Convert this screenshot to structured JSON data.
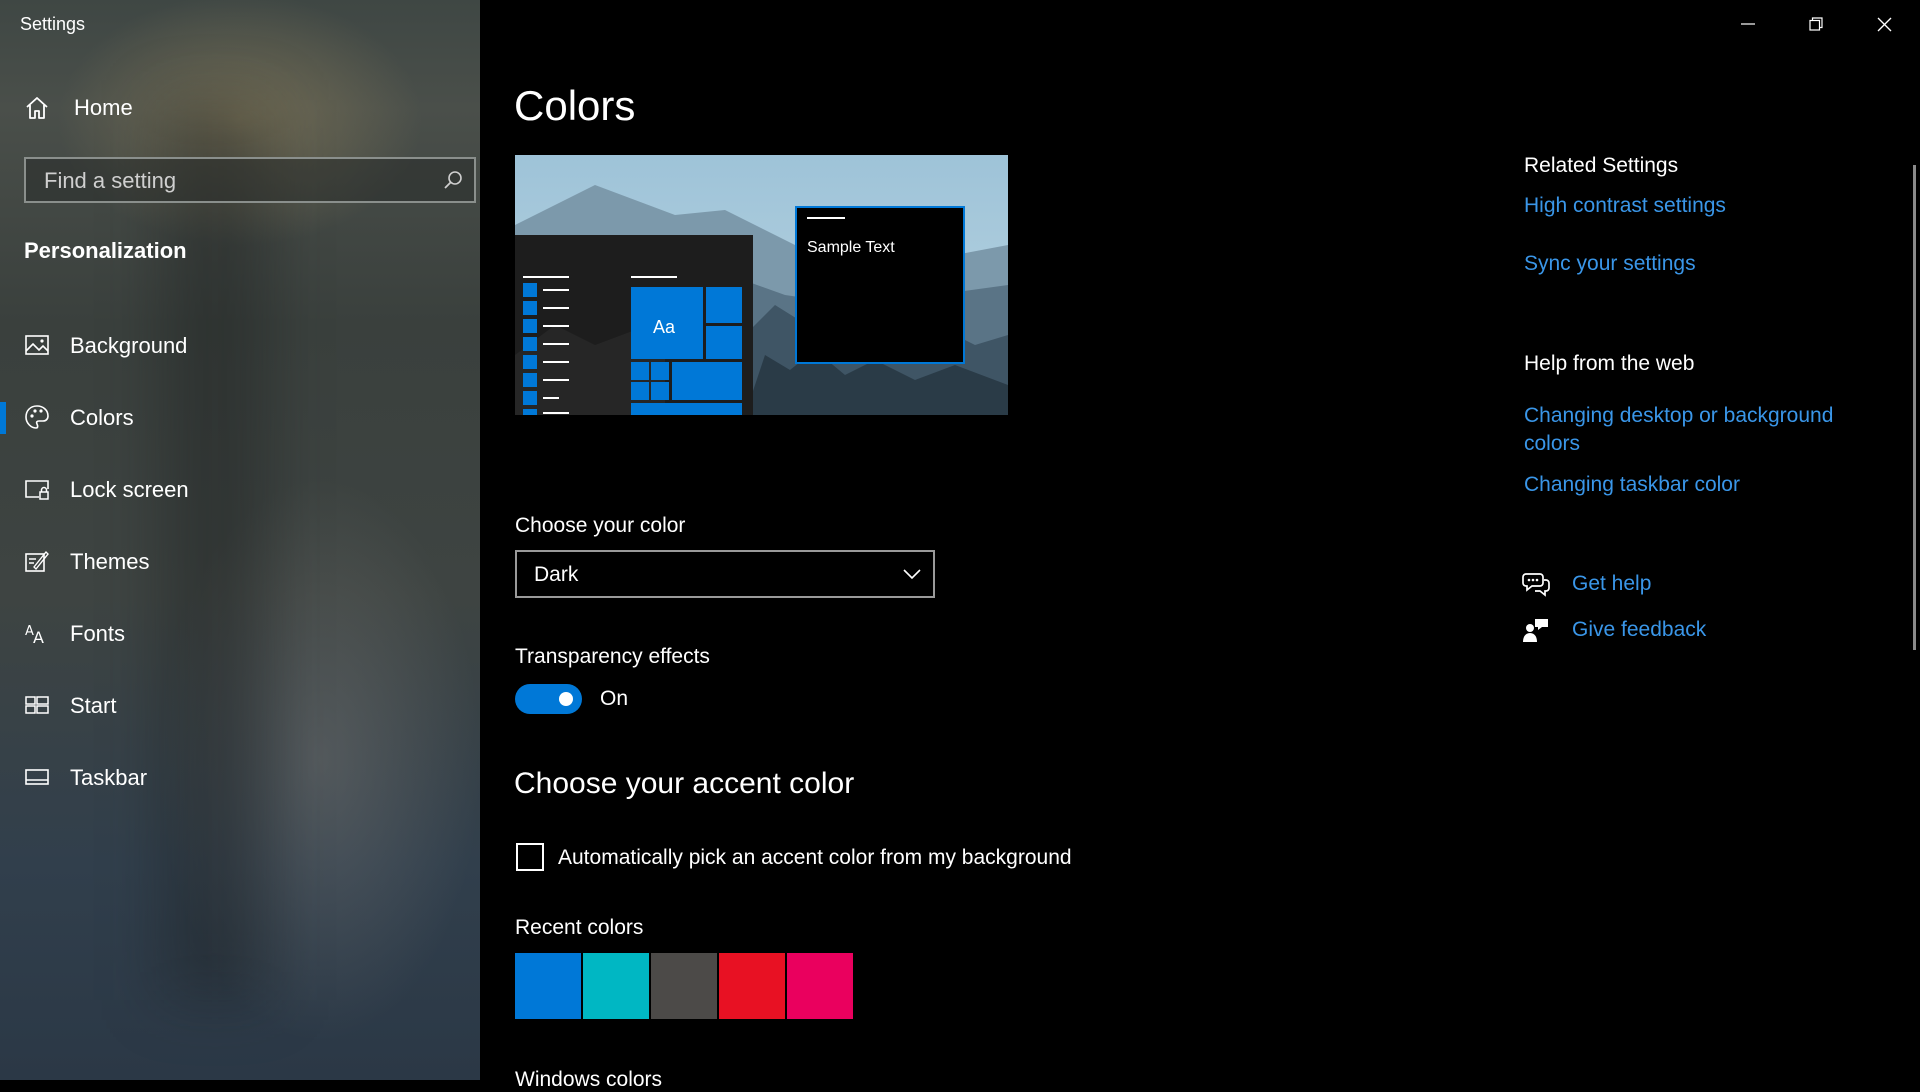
{
  "window": {
    "title": "Settings",
    "minimize_icon": "minimize-icon",
    "restore_icon": "restore-icon",
    "close_icon": "close-icon"
  },
  "sidebar": {
    "home_label": "Home",
    "search_placeholder": "Find a setting",
    "section_title": "Personalization",
    "items": [
      {
        "label": "Background",
        "icon": "picture-icon",
        "active": false
      },
      {
        "label": "Colors",
        "icon": "palette-icon",
        "active": true
      },
      {
        "label": "Lock screen",
        "icon": "lock-screen-icon",
        "active": false
      },
      {
        "label": "Themes",
        "icon": "themes-icon",
        "active": false
      },
      {
        "label": "Fonts",
        "icon": "fonts-icon",
        "active": false
      },
      {
        "label": "Start",
        "icon": "start-icon",
        "active": false
      },
      {
        "label": "Taskbar",
        "icon": "taskbar-icon",
        "active": false
      }
    ]
  },
  "main": {
    "title": "Colors",
    "preview": {
      "sample_text": "Sample Text",
      "tile_text": "Aa"
    },
    "choose_color_label": "Choose your color",
    "choose_color_value": "Dark",
    "transparency_label": "Transparency effects",
    "transparency_state": "On",
    "accent_heading": "Choose your accent color",
    "auto_pick_label": "Automatically pick an accent color from my background",
    "auto_pick_checked": false,
    "recent_colors_label": "Recent colors",
    "recent_colors": [
      "#0078d7",
      "#00b7c3",
      "#4c4a48",
      "#e81123",
      "#ea005e"
    ],
    "next_section_partial": "Windows colors"
  },
  "related": {
    "related_heading": "Related Settings",
    "high_contrast": "High contrast settings",
    "sync": "Sync your settings",
    "help_heading": "Help from the web",
    "help_links": [
      "Changing desktop or background colors",
      "Changing taskbar color"
    ],
    "get_help": "Get help",
    "give_feedback": "Give feedback"
  },
  "colors": {
    "accent": "#0078d7",
    "link": "#3a96e8",
    "background": "#000000"
  }
}
